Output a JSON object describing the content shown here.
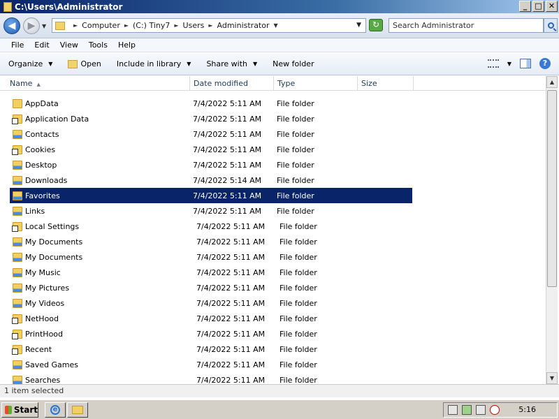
{
  "window": {
    "title": "C:\\Users\\Administrator",
    "buttons": {
      "minimize": "_",
      "maximize": "□",
      "close": "✕"
    }
  },
  "address": {
    "crumbs": [
      "Computer",
      "(C:) Tiny7",
      "Users",
      "Administrator"
    ],
    "search_placeholder": "Search Administrator"
  },
  "menu": [
    "File",
    "Edit",
    "View",
    "Tools",
    "Help"
  ],
  "toolbar": {
    "organize": "Organize",
    "open": "Open",
    "include": "Include in library",
    "share": "Share with",
    "new_folder": "New folder"
  },
  "columns": {
    "name": "Name",
    "date": "Date modified",
    "type": "Type",
    "size": "Size"
  },
  "files": [
    {
      "name": "AppData",
      "date": "7/4/2022 5:11 AM",
      "type": "File folder",
      "icon": "folder-icon"
    },
    {
      "name": "Application Data",
      "date": "7/4/2022 5:11 AM",
      "type": "File folder",
      "icon": "folder-shortcut-icon"
    },
    {
      "name": "Contacts",
      "date": "7/4/2022 5:11 AM",
      "type": "File folder",
      "icon": "contacts-folder-icon"
    },
    {
      "name": "Cookies",
      "date": "7/4/2022 5:11 AM",
      "type": "File folder",
      "icon": "folder-shortcut-icon"
    },
    {
      "name": "Desktop",
      "date": "7/4/2022 5:11 AM",
      "type": "File folder",
      "icon": "desktop-folder-icon"
    },
    {
      "name": "Downloads",
      "date": "7/4/2022 5:14 AM",
      "type": "File folder",
      "icon": "downloads-folder-icon"
    },
    {
      "name": "Favorites",
      "date": "7/4/2022 5:11 AM",
      "type": "File folder",
      "icon": "favorites-folder-icon",
      "selected": true
    },
    {
      "name": "Links",
      "date": "7/4/2022 5:11 AM",
      "type": "File folder",
      "icon": "links-folder-icon"
    },
    {
      "name": "Local Settings",
      "date": "7/4/2022 5:11 AM",
      "type": "File folder",
      "icon": "folder-shortcut-icon"
    },
    {
      "name": "My Documents",
      "date": "7/4/2022 5:11 AM",
      "type": "File folder",
      "icon": "documents-folder-icon"
    },
    {
      "name": "My Documents",
      "date": "7/4/2022 5:11 AM",
      "type": "File folder",
      "icon": "documents-folder-icon"
    },
    {
      "name": "My Music",
      "date": "7/4/2022 5:11 AM",
      "type": "File folder",
      "icon": "music-folder-icon"
    },
    {
      "name": "My Pictures",
      "date": "7/4/2022 5:11 AM",
      "type": "File folder",
      "icon": "pictures-folder-icon"
    },
    {
      "name": "My Videos",
      "date": "7/4/2022 5:11 AM",
      "type": "File folder",
      "icon": "videos-folder-icon"
    },
    {
      "name": "NetHood",
      "date": "7/4/2022 5:11 AM",
      "type": "File folder",
      "icon": "folder-shortcut-icon"
    },
    {
      "name": "PrintHood",
      "date": "7/4/2022 5:11 AM",
      "type": "File folder",
      "icon": "folder-shortcut-icon"
    },
    {
      "name": "Recent",
      "date": "7/4/2022 5:11 AM",
      "type": "File folder",
      "icon": "folder-shortcut-icon"
    },
    {
      "name": "Saved Games",
      "date": "7/4/2022 5:11 AM",
      "type": "File folder",
      "icon": "saved-games-folder-icon"
    },
    {
      "name": "Searches",
      "date": "7/4/2022 5:11 AM",
      "type": "File folder",
      "icon": "searches-folder-icon"
    }
  ],
  "status": {
    "text": "1 item selected"
  },
  "taskbar": {
    "start": "Start",
    "clock": "5:16"
  },
  "colors": {
    "selection": "#0a246a",
    "titlebar": "#0a246a",
    "taskbar": "#d4d0c8"
  }
}
